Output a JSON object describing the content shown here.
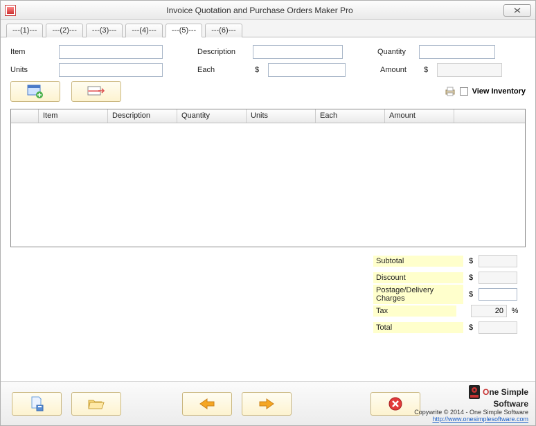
{
  "window": {
    "title": "Invoice Quotation and Purchase Orders Maker Pro"
  },
  "tabs": [
    {
      "label": "---(1)---"
    },
    {
      "label": "---(2)---"
    },
    {
      "label": "---(3)---"
    },
    {
      "label": "---(4)---"
    },
    {
      "label": "---(5)---",
      "active": true
    },
    {
      "label": "---(6)---"
    }
  ],
  "fields": {
    "item_label": "Item",
    "units_label": "Units",
    "description_label": "Description",
    "each_label": "Each",
    "quantity_label": "Quantity",
    "amount_label": "Amount",
    "currency": "$",
    "item_value": "",
    "units_value": "",
    "description_value": "",
    "each_value": "",
    "quantity_value": "",
    "amount_value": ""
  },
  "view_inventory": {
    "label": "View Inventory",
    "checked": false
  },
  "grid": {
    "columns": [
      "",
      "Item",
      "Description",
      "Quantity",
      "Units",
      "Each",
      "Amount"
    ],
    "rows": []
  },
  "summary": {
    "subtotal_label": "Subtotal",
    "discount_label": "Discount",
    "postage_label": "Postage/Delivery Charges",
    "tax_label": "Tax",
    "total_label": "Total",
    "currency": "$",
    "subtotal_value": "",
    "discount_value": "",
    "postage_value": "",
    "tax_value": "20",
    "tax_unit": "%",
    "total_value": ""
  },
  "brand": {
    "name_o": "O",
    "name_rest": "ne Simple",
    "name_line2": "Software",
    "copy": "Copywrite © 2014 - One Simple Software",
    "url": "http://www.onesimplesoftware.com"
  }
}
